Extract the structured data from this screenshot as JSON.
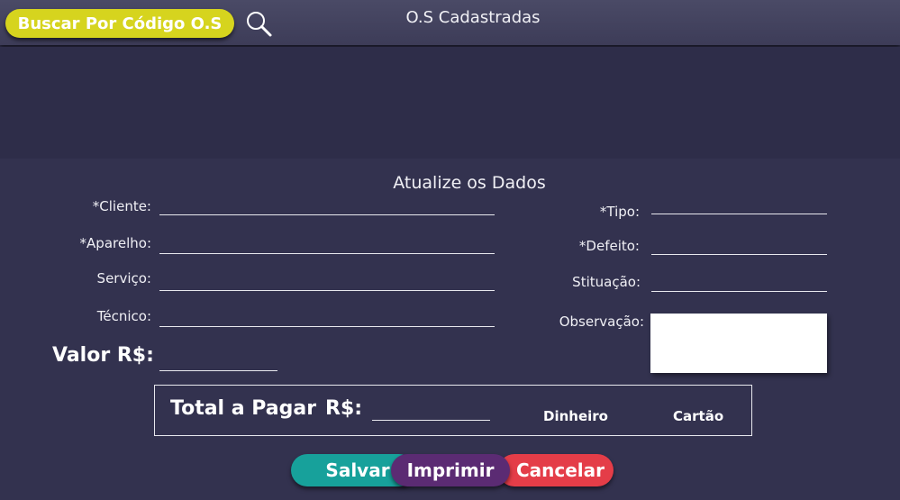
{
  "header": {
    "search_button_label": "Buscar Por Código O.S",
    "title": "O.S Cadastradas"
  },
  "form": {
    "section_title": "Atualize os Dados",
    "left_fields": [
      {
        "label": "*Cliente:",
        "value": ""
      },
      {
        "label": "*Aparelho:",
        "value": ""
      },
      {
        "label": "Serviço:",
        "value": ""
      },
      {
        "label": "Técnico:",
        "value": ""
      }
    ],
    "right_fields": [
      {
        "label": "*Tipo:",
        "value": ""
      },
      {
        "label": "*Defeito:",
        "value": ""
      },
      {
        "label": "Stituação:",
        "value": ""
      }
    ],
    "observacao_label": "Observação:",
    "observacao_value": "",
    "valor_label": "Valor R$:",
    "valor_value": ""
  },
  "total": {
    "label": "Total a Pagar",
    "currency": "R$:",
    "value": "",
    "payment_options": [
      "Dinheiro",
      "Cartão"
    ]
  },
  "buttons": {
    "save": "Salvar",
    "print": "Imprimir",
    "cancel": "Cancelar"
  },
  "colors": {
    "background": "#2e2d49",
    "search_button": "#d6d41e",
    "save_button": "#17a19b",
    "print_button": "#5b2b73",
    "cancel_button": "#e43d48"
  },
  "icons": {
    "search": "magnifier-icon"
  }
}
